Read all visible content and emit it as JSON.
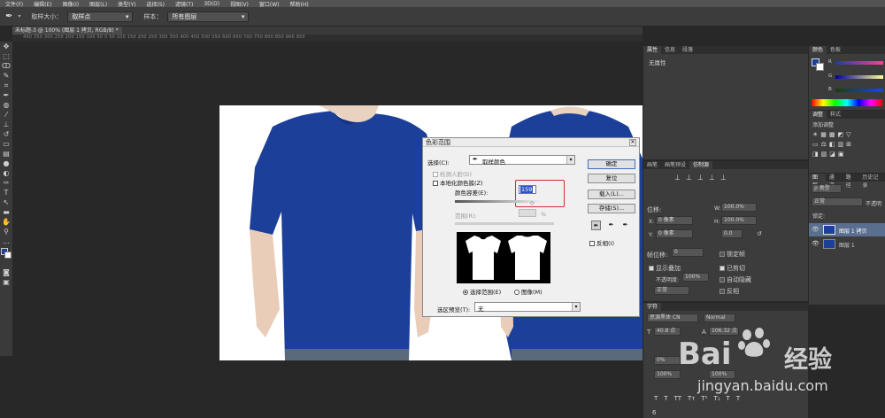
{
  "menu": [
    "文件(F)",
    "编辑(E)",
    "图像(I)",
    "图层(L)",
    "类型(Y)",
    "选择(S)",
    "滤镜(T)",
    "3D(D)",
    "视图(V)",
    "窗口(W)",
    "帮助(H)"
  ],
  "options": {
    "sample_size_label": "取样大小：",
    "sample_size_value": "取样点",
    "sample_label": "样本：",
    "sample_value": "所有图层"
  },
  "document": {
    "tab_title": "未标题-3 @ 100% (图层 1 拷贝, RGB/8) *",
    "ruler_marks": "400  350  300  250  200  150  100  50  0  50  100  150  200  250  300  350  400  450  500  550  600  650  700  750  800  850  900  950"
  },
  "dialog": {
    "title": "色彩范围",
    "select_label": "选择(C):",
    "select_value": "取样颜色",
    "detect_faces": "检测人脸(D)",
    "localized_clusters": "本地化颜色簇(Z)",
    "fuzziness_label": "颜色容差(E):",
    "fuzziness_value": "159",
    "range_label": "范围(R):",
    "range_unit": "%",
    "radio_selection": "选择范围(E)",
    "radio_image": "图像(M)",
    "preview_label": "选区预览(T):",
    "preview_value": "无",
    "ok": "确定",
    "reset": "复位",
    "load": "载入(L)...",
    "save": "存储(S)...",
    "invert": "反相(I)",
    "highlight_color": "#d0302a"
  },
  "properties": {
    "tabs": [
      "属性",
      "信息",
      "段落"
    ],
    "no_props": "无属性"
  },
  "color": {
    "tabs": [
      "颜色",
      "色板"
    ],
    "channels": [
      "R",
      "G",
      "B"
    ]
  },
  "adjustments": {
    "tabs": [
      "调整",
      "样式"
    ],
    "add": "添加调整"
  },
  "brush": {
    "tabs": [
      "画笔",
      "画笔预设",
      "仿制源"
    ],
    "offset_label": "位移:",
    "x_label": "X:",
    "x_value": "0 像素",
    "y_label": "Y:",
    "y_value": "0 像素",
    "w_label": "W:",
    "w_value": "100.0%",
    "h_label": "H:",
    "h_value": "100.0%",
    "angle_value": "0.0",
    "frame_label": "帧位移:",
    "frame_value": "0",
    "lock_frame": "锁定帧",
    "show_overlay": "显示叠加",
    "opacity_label": "不透明度:",
    "opacity_value": "100%",
    "clipped": "已剪切",
    "auto_hide": "自动隐藏",
    "normal": "正常",
    "invert": "反相"
  },
  "layers": {
    "tabs": [
      "图层",
      "通道",
      "路径",
      "历史记录"
    ],
    "kind": "ρ 类型",
    "mode": "正常",
    "opacity_label": "不透明",
    "lock_label": "锁定:",
    "items": [
      "图层 1 拷贝",
      "图层 1"
    ]
  },
  "character": {
    "tab": "字符",
    "font": "思源黑体 CN",
    "style": "Normal",
    "size": "40.8 点",
    "leading": "106.32 点",
    "tracking_a": "0%",
    "scale_a": "100%",
    "scale_b": "100%",
    "text_buttons": [
      "T",
      "T",
      "TT",
      "Tт",
      "T¹",
      "T₁",
      "T",
      "T"
    ],
    "footer_num": "6"
  },
  "watermark": {
    "brand": "Bai",
    "brand2": "经验",
    "url": "jingyan.baidu.com"
  }
}
